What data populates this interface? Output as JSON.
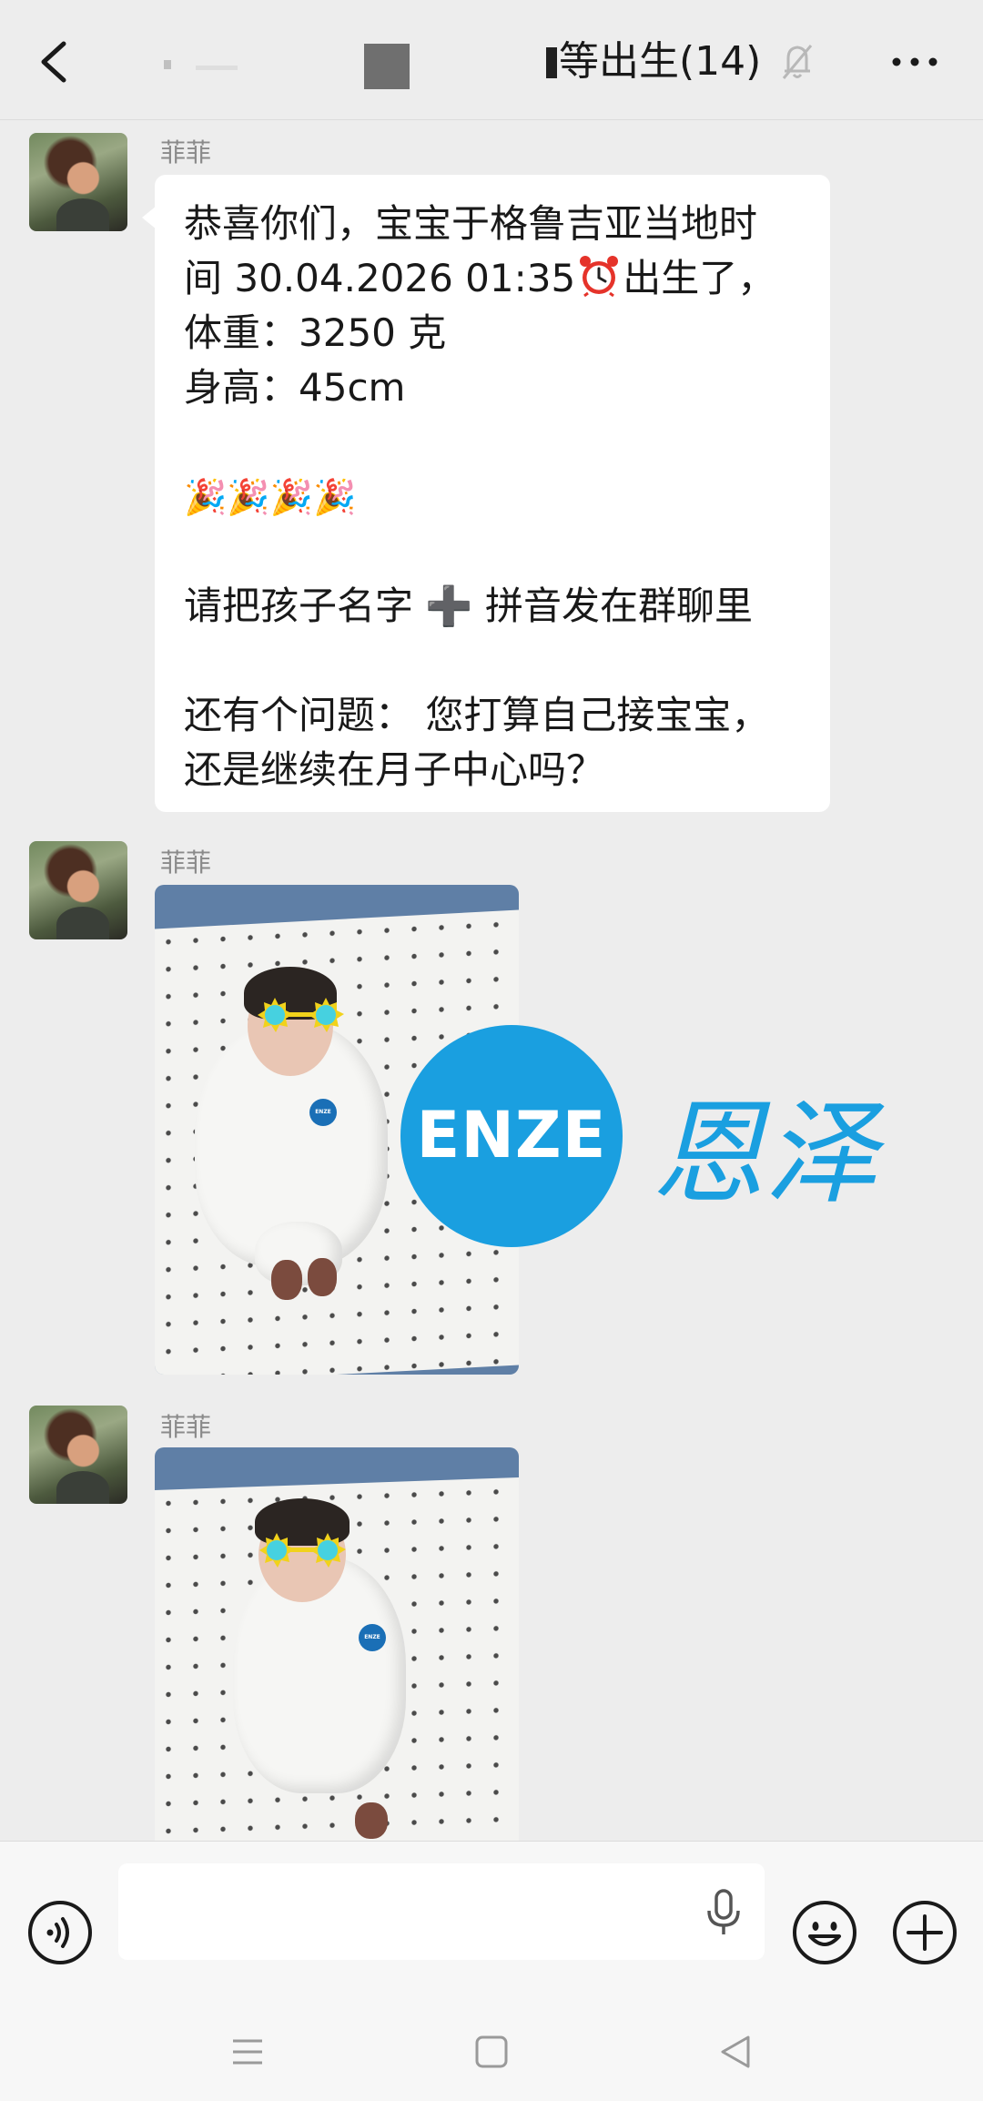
{
  "header": {
    "title": "等出生(14)"
  },
  "messages": [
    {
      "sender": "菲菲",
      "type": "text",
      "lines": [
        "恭喜你们，宝宝于格鲁吉亚当地时",
        "间 30.04.2026 01:35",
        "出生了，",
        "体重：3250 克",
        "身高：45cm",
        "🎉🎉🎉🎉",
        "请把孩子名字 ➕ 拼音发在群聊里",
        "还有个问题： 您打算自己接宝宝，",
        "还是继续在月子中心吗？"
      ]
    },
    {
      "sender": "菲菲",
      "type": "image"
    },
    {
      "sender": "菲菲",
      "type": "image"
    }
  ],
  "watermark": {
    "logo_text": "ENZE",
    "cn_text": "恩泽"
  },
  "input": {
    "value": "",
    "placeholder": ""
  },
  "colors": {
    "background": "#ededed",
    "bubble": "#ffffff",
    "brand": "#1a9fe0"
  },
  "icons": {
    "back": "chevron-left-icon",
    "mute": "bell-off-icon",
    "more": "more-dots-icon",
    "voice": "voice-icon",
    "mic": "microphone-icon",
    "emoji": "smiley-icon",
    "plus": "plus-icon",
    "clock": "alarm-clock-icon"
  }
}
